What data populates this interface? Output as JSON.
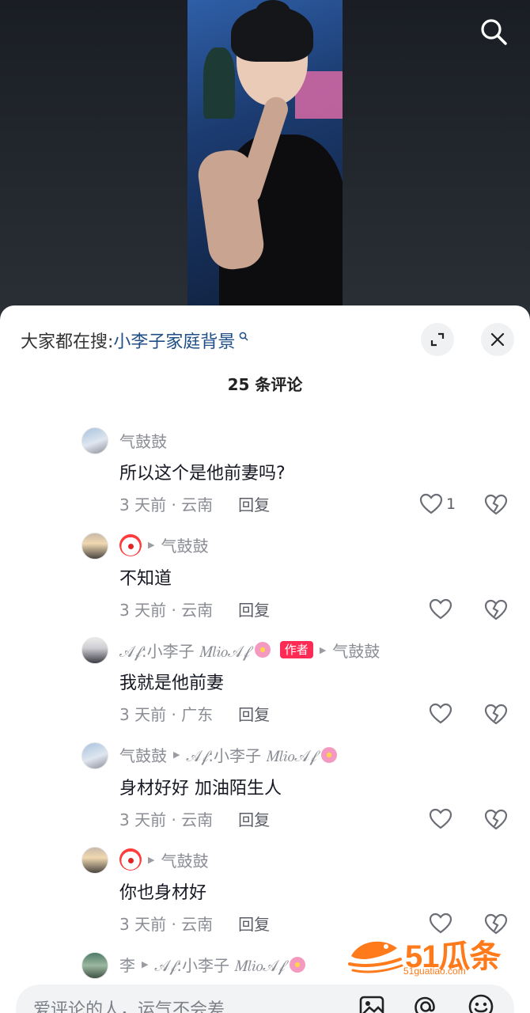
{
  "sheet": {
    "hot_search_prefix": "大家都在搜:",
    "hot_search_term": "小李子家庭背景",
    "comment_count": "25 条评论"
  },
  "comments": [
    {
      "user": "气鼓鼓",
      "reply_to": "",
      "text": "所以这个是他前妻吗?",
      "time_loc": "3 天前 · 云南",
      "reply_label": "回复",
      "likes": "1"
    },
    {
      "user": "",
      "reply_to": "气鼓鼓",
      "text": "不知道",
      "time_loc": "3 天前 · 云南",
      "reply_label": "回复",
      "likes": ""
    },
    {
      "user": "𝒜𝒻:小李子 𝑀𝑙𝑖𝑜𝒜𝒻",
      "author_badge": "作者",
      "reply_to": "气鼓鼓",
      "text": "我就是他前妻",
      "time_loc": "3 天前 · 广东",
      "reply_label": "回复",
      "likes": ""
    },
    {
      "user": "气鼓鼓",
      "reply_to": "𝒜𝒻:小李子 𝑀𝑙𝑖𝑜𝒜𝒻",
      "text": "身材好好 加油陌生人",
      "time_loc": "3 天前 · 云南",
      "reply_label": "回复",
      "likes": ""
    },
    {
      "user": "",
      "reply_to": "气鼓鼓",
      "text": "你也身材好",
      "time_loc": "3 天前 · 云南",
      "reply_label": "回复",
      "likes": ""
    },
    {
      "user": "李",
      "reply_to": "𝒜𝒻:小李子 𝑀𝑙𝑖𝑜𝒜𝒻",
      "text": "",
      "time_loc": "",
      "reply_label": "",
      "likes": ""
    }
  ],
  "watermark": {
    "brand": "51瓜条",
    "url": "51guatiao.com"
  },
  "input": {
    "placeholder": "爱评论的人，运气不会差"
  },
  "icons": {
    "top_search": "search-icon",
    "expand": "expand-icon",
    "close": "close-icon",
    "like": "heart-icon",
    "dislike": "broken-heart-icon",
    "image": "image-icon",
    "at": "at-icon",
    "emoji": "emoji-icon"
  },
  "colors": {
    "accent_link": "#1f4f86",
    "author_badge": "#fe2c55",
    "watermark": "#ff7a1a"
  }
}
